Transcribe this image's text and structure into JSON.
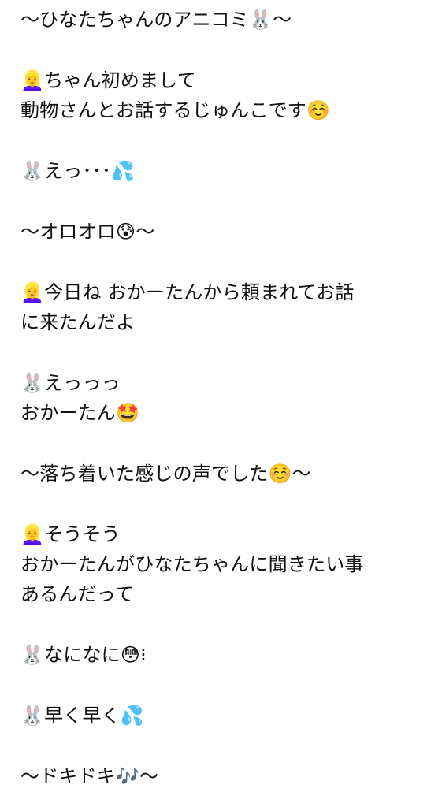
{
  "story": {
    "lines": [
      "〜ひなたちゃんのアニコミ🐰〜",
      "",
      "👱‍♀️ちゃん初めまして",
      "動物さんとお話するじゅんこです☺️",
      "",
      "🐰えっ･･･💦",
      "",
      "〜オロオロ😰〜",
      "",
      "👱‍♀️今日ね おかーたんから頼まれてお話",
      "に来たんだよ",
      "",
      "🐰えっっっ",
      "おかーたん🤩",
      "",
      "〜落ち着いた感じの声でした☺️〜",
      "",
      "👱‍♀️そうそう",
      "おかーたんがひなたちゃんに聞きたい事",
      "あるんだって",
      "",
      "🐰なになに😳⁝",
      "",
      "🐰早く早く💦",
      "",
      "〜ドキドキ🎶〜"
    ]
  }
}
